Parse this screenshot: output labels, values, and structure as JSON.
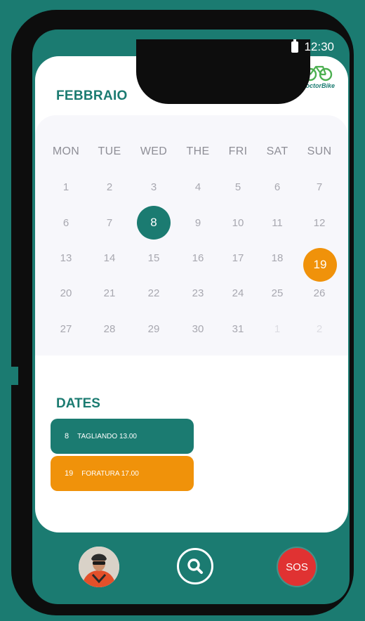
{
  "status_bar": {
    "time": "12:30"
  },
  "brand": {
    "logo_text": "DoctorBike"
  },
  "calendar": {
    "month": "FEBBRAIO",
    "weekdays": [
      "MON",
      "TUE",
      "WED",
      "THE",
      "FRI",
      "SAT",
      "SUN"
    ],
    "weeks": [
      [
        "1",
        "2",
        "3",
        "4",
        "5",
        "6",
        "7"
      ],
      [
        "6",
        "7",
        "8",
        "9",
        "10",
        "11",
        "12"
      ],
      [
        "13",
        "14",
        "15",
        "16",
        "17",
        "18",
        "19"
      ],
      [
        "20",
        "21",
        "22",
        "23",
        "24",
        "25",
        "26"
      ],
      [
        "27",
        "28",
        "29",
        "30",
        "31",
        "1",
        "2"
      ]
    ],
    "highlights": [
      {
        "day": "8",
        "color": "#1b7b71"
      },
      {
        "day": "19",
        "color": "#f0920a"
      }
    ]
  },
  "dates": {
    "title": "DATES",
    "events": [
      {
        "day": "8",
        "label": "TAGLIANDO 13.00",
        "color": "#1b7b71"
      },
      {
        "day": "19",
        "label": "FORATURA 17.00",
        "color": "#f0920a"
      }
    ]
  },
  "nav": {
    "sos_label": "SOS"
  },
  "colors": {
    "primary": "#1b7b71",
    "accent": "#f0920a",
    "danger": "#e03232"
  }
}
